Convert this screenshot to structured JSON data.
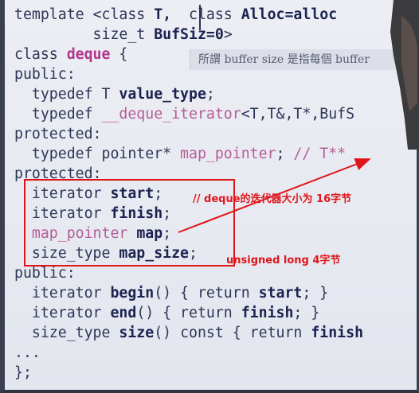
{
  "code_lines": [
    {
      "segments": [
        {
          "t": "template <class "
        },
        {
          "t": "T,",
          "c": "b"
        },
        {
          "t": "  class "
        },
        {
          "t": "Alloc=alloc",
          "c": "b"
        }
      ]
    },
    {
      "segments": [
        {
          "t": "         size_t "
        },
        {
          "t": "BufSiz=0",
          "c": "b"
        },
        {
          "t": ">"
        }
      ]
    },
    {
      "segments": [
        {
          "t": "class "
        },
        {
          "t": "deque",
          "c": "em"
        },
        {
          "t": " {"
        }
      ]
    },
    {
      "segments": [
        {
          "t": "public:"
        }
      ]
    },
    {
      "segments": [
        {
          "t": "  typedef T "
        },
        {
          "t": "value_type",
          "c": "b"
        },
        {
          "t": ";"
        }
      ]
    },
    {
      "segments": [
        {
          "t": "  typedef "
        },
        {
          "t": "__deque_iterator",
          "c": "pink"
        },
        {
          "t": "<T,T&,T*,BufS"
        }
      ]
    },
    {
      "segments": [
        {
          "t": "protected:"
        }
      ]
    },
    {
      "segments": [
        {
          "t": "  typedef pointer* "
        },
        {
          "t": "map_pointer",
          "c": "pink"
        },
        {
          "t": "; "
        },
        {
          "t": "// T**",
          "c": "pink"
        }
      ]
    },
    {
      "segments": [
        {
          "t": "protected:"
        }
      ]
    },
    {
      "segments": [
        {
          "t": "  iterator "
        },
        {
          "t": "start",
          "c": "b"
        },
        {
          "t": ";"
        }
      ]
    },
    {
      "segments": [
        {
          "t": "  iterator "
        },
        {
          "t": "finish",
          "c": "b"
        },
        {
          "t": ";"
        }
      ]
    },
    {
      "segments": [
        {
          "t": "  map_pointer ",
          "c": "pink"
        },
        {
          "t": "map",
          "c": "b"
        },
        {
          "t": ";"
        }
      ]
    },
    {
      "segments": [
        {
          "t": "  size_type "
        },
        {
          "t": "map_size",
          "c": "b"
        },
        {
          "t": ";"
        }
      ]
    },
    {
      "segments": [
        {
          "t": "public:"
        }
      ]
    },
    {
      "segments": [
        {
          "t": "  iterator "
        },
        {
          "t": "begin",
          "c": "b"
        },
        {
          "t": "() { return "
        },
        {
          "t": "start",
          "c": "b"
        },
        {
          "t": "; }"
        }
      ]
    },
    {
      "segments": [
        {
          "t": "  iterator "
        },
        {
          "t": "end",
          "c": "b"
        },
        {
          "t": "() { return "
        },
        {
          "t": "finish",
          "c": "b"
        },
        {
          "t": "; }"
        }
      ]
    },
    {
      "segments": [
        {
          "t": "  size_type "
        },
        {
          "t": "size",
          "c": "b"
        },
        {
          "t": "() const { return "
        },
        {
          "t": "finish",
          "c": "b"
        }
      ]
    },
    {
      "segments": [
        {
          "t": "..."
        }
      ]
    },
    {
      "segments": [
        {
          "t": "};"
        }
      ]
    }
  ],
  "note": "所謂 buffer size 是指每個 buffer",
  "annotations": {
    "iterator_size": "// deque的迭代器大小为 16字节",
    "map_size_type": "unsigned long  4字节"
  },
  "colors": {
    "annotation": "#e0151a",
    "keyword_emphasis": "#b0368a",
    "code": "#2e3556"
  }
}
